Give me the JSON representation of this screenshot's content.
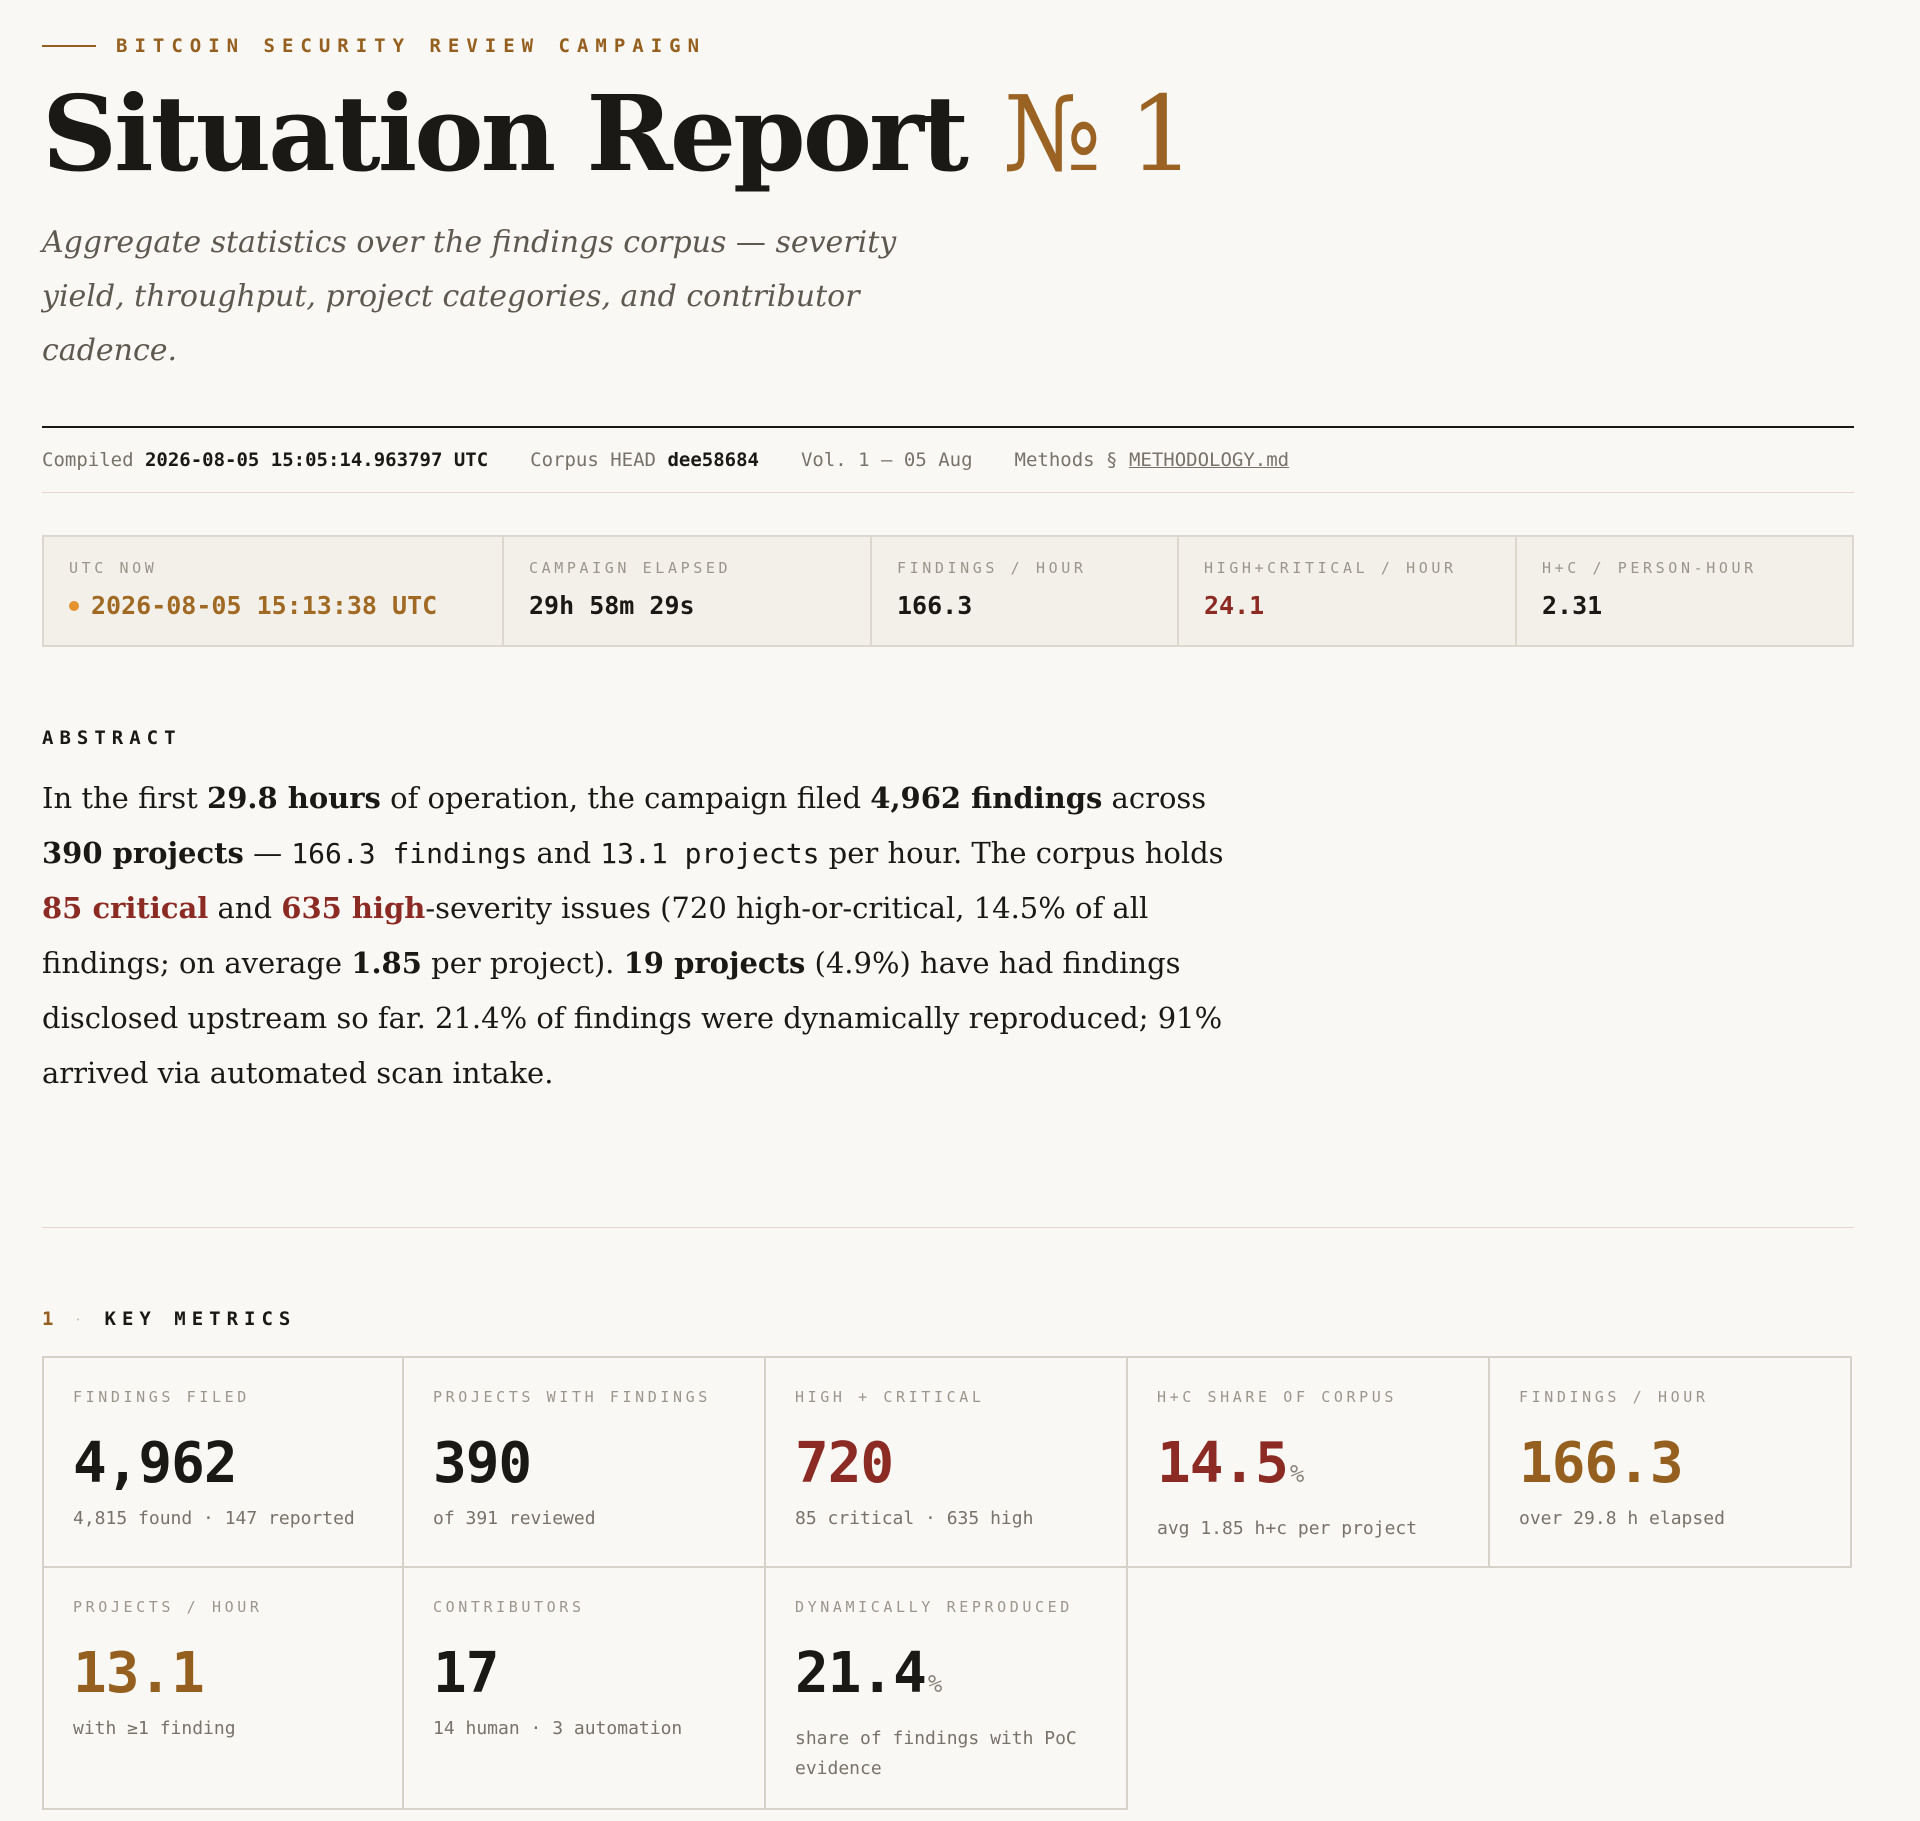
{
  "header": {
    "kicker": "BITCOIN SECURITY REVIEW CAMPAIGN",
    "title": "Situation Report",
    "title_number": "№ 1",
    "subtitle": "Aggregate statistics over the findings corpus — severity yield, throughput, project categories, and contributor cadence."
  },
  "meta": {
    "compiled_label": "Compiled",
    "compiled_value": "2026-08-05 15:05:14.963797 UTC",
    "corpus_label": "Corpus HEAD",
    "corpus_value": "dee58684",
    "volume": "Vol. 1 — 05 Aug",
    "methods_label": "Methods §",
    "methods_link": "METHODOLOGY.md"
  },
  "status": [
    {
      "label": "UTC NOW",
      "value": "2026-08-05 15:13:38 UTC",
      "tone": "amber",
      "live": true
    },
    {
      "label": "CAMPAIGN ELAPSED",
      "value": "29h 58m 29s",
      "tone": "default"
    },
    {
      "label": "FINDINGS / HOUR",
      "value": "166.3",
      "tone": "default"
    },
    {
      "label": "HIGH+CRITICAL / HOUR",
      "value": "24.1",
      "tone": "red"
    },
    {
      "label": "H+C / PERSON-HOUR",
      "value": "2.31",
      "tone": "default"
    }
  ],
  "abstract": {
    "label": "ABSTRACT",
    "t1": "In the first ",
    "hours": "29.8 hours",
    "t2": " of operation, the campaign filed ",
    "findings": "4,962 findings",
    "t3": " across ",
    "projects": "390 projects",
    "t4": " — ",
    "rate_findings": "166.3 findings",
    "t5": " and ",
    "rate_projects": "13.1 projects",
    "t6": " per hour. The corpus holds ",
    "critical": "85 critical",
    "t7": " and ",
    "high": "635 high",
    "t8": "-severity issues (720 high-or-critical, 14.5% of all findings; on average ",
    "avg": "1.85",
    "t9": " per project). ",
    "disclosed": "19 projects",
    "t10": " (4.9%) have had findings disclosed upstream so far. 21.4% of findings were dynamically reproduced; 91% arrived via automated scan intake."
  },
  "key_metrics": {
    "number": "1",
    "separator": "·",
    "title": "KEY METRICS",
    "items": [
      {
        "label": "FINDINGS FILED",
        "value": "4,962",
        "unit": "",
        "sub": "4,815 found · 147 reported",
        "tone": "default"
      },
      {
        "label": "PROJECTS WITH FINDINGS",
        "value": "390",
        "unit": "",
        "sub": "of 391 reviewed",
        "tone": "default"
      },
      {
        "label": "HIGH + CRITICAL",
        "value": "720",
        "unit": "",
        "sub": "85 critical · 635 high",
        "tone": "red"
      },
      {
        "label": "H+C SHARE OF CORPUS",
        "value": "14.5",
        "unit": "%",
        "sub": "avg 1.85 h+c per project",
        "tone": "red"
      },
      {
        "label": "FINDINGS / HOUR",
        "value": "166.3",
        "unit": "",
        "sub": "over 29.8 h elapsed",
        "tone": "amber"
      },
      {
        "label": "PROJECTS / HOUR",
        "value": "13.1",
        "unit": "",
        "sub": "with ≥1 finding",
        "tone": "amber"
      },
      {
        "label": "CONTRIBUTORS",
        "value": "17",
        "unit": "",
        "sub": "14 human · 3 automation",
        "tone": "default"
      },
      {
        "label": "DYNAMICALLY REPRODUCED",
        "value": "21.4",
        "unit": "%",
        "sub": "share of findings with PoC evidence",
        "tone": "default"
      }
    ]
  },
  "colors": {
    "background": "#faf8f4",
    "accent_amber": "#95601f",
    "accent_red": "#8c2a24",
    "live_dot": "#e3922f"
  }
}
